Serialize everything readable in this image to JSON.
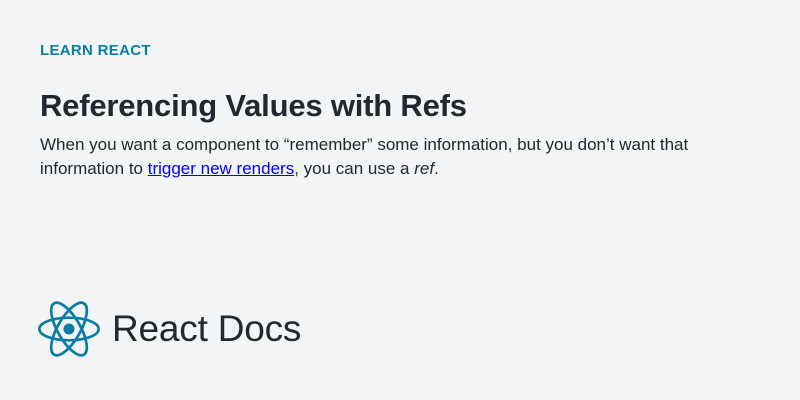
{
  "eyebrow": "LEARN REACT",
  "title": "Referencing Values with Refs",
  "description": {
    "before": "When you want a component to “remember” some information, but you don’t want that information to ",
    "link_text": "trigger new renders",
    "middle": ", you can use a ",
    "emphasis": "ref",
    "after": "."
  },
  "brand": {
    "name": "React Docs",
    "icon": "react-logo-icon"
  },
  "colors": {
    "background": "#f3f4f6",
    "accent": "#087ea4",
    "text": "#23272f",
    "link": "#0000ee"
  }
}
